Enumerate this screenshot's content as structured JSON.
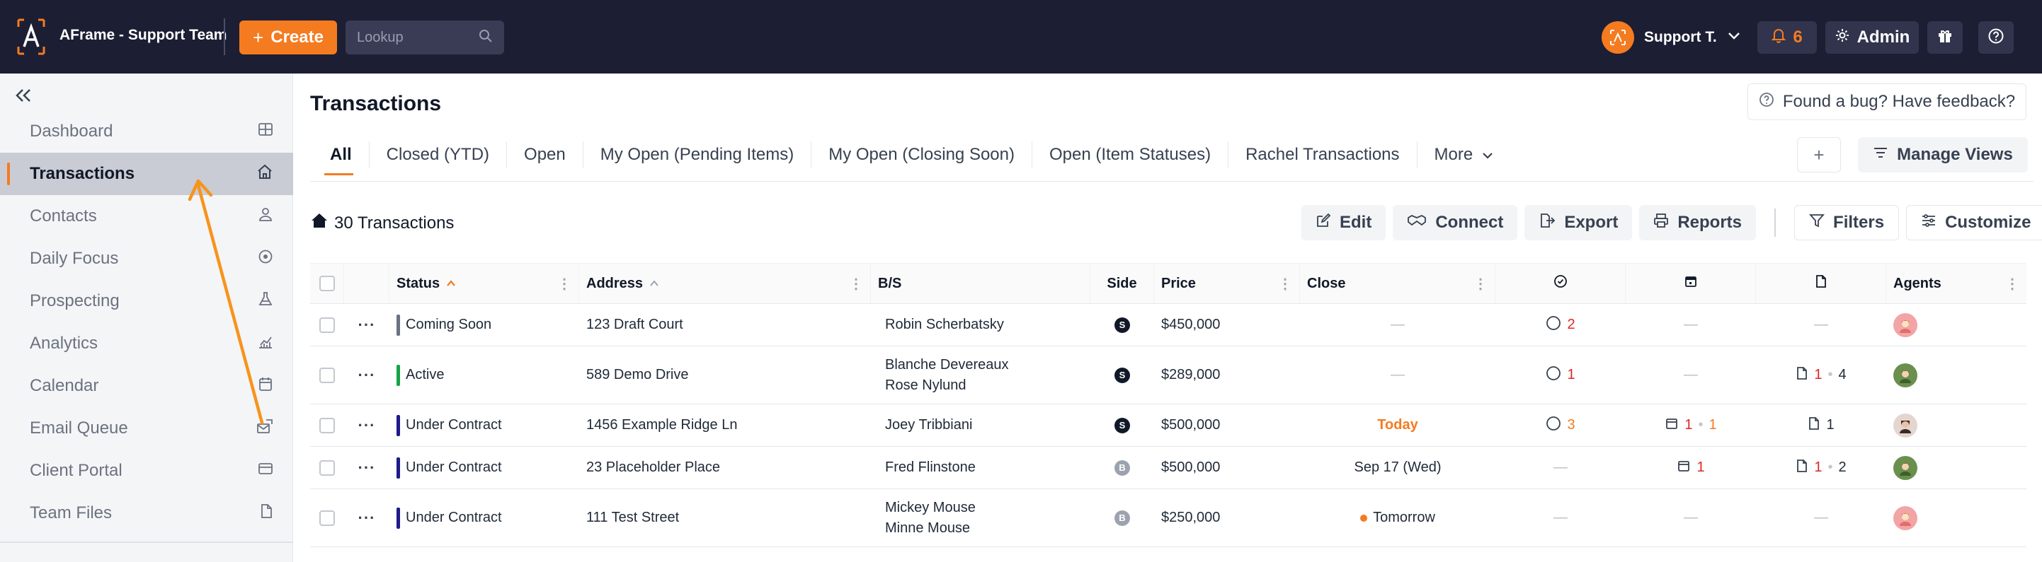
{
  "app": {
    "title": "AFrame - Support Team",
    "create_label": "Create",
    "lookup_placeholder": "Lookup"
  },
  "user": {
    "name": "Support T.",
    "notifications": "6",
    "admin_label": "Admin"
  },
  "colors": {
    "brand": "#f47b20",
    "topbar": "#1c1e34",
    "sidebar": "#f4f5f7"
  },
  "sidebar": {
    "items": [
      {
        "label": "Dashboard",
        "icon": "grid-icon"
      },
      {
        "label": "Transactions",
        "icon": "home-icon",
        "active": true
      },
      {
        "label": "Contacts",
        "icon": "person-icon"
      },
      {
        "label": "Daily Focus",
        "icon": "target-icon"
      },
      {
        "label": "Prospecting",
        "icon": "flask-icon"
      },
      {
        "label": "Analytics",
        "icon": "chart-icon"
      },
      {
        "label": "Calendar",
        "icon": "calendar-icon"
      },
      {
        "label": "Email Queue",
        "icon": "email-queue-icon"
      },
      {
        "label": "Client Portal",
        "icon": "portal-icon"
      },
      {
        "label": "Team Files",
        "icon": "file-icon"
      }
    ]
  },
  "main": {
    "title": "Transactions",
    "feedback": "Found a bug? Have feedback?",
    "tabs": [
      "All",
      "Closed (YTD)",
      "Open",
      "My Open (Pending Items)",
      "My Open (Closing Soon)",
      "Open (Item Statuses)",
      "Rachel Transactions",
      "More"
    ],
    "manage_views": "Manage Views",
    "count": "30 Transactions",
    "toolbar": {
      "edit": "Edit",
      "connect": "Connect",
      "export": "Export",
      "reports": "Reports",
      "filters": "Filters",
      "customize": "Customize"
    }
  },
  "table": {
    "headers": {
      "status": "Status",
      "address": "Address",
      "bs": "B/S",
      "side": "Side",
      "price": "Price",
      "close": "Close",
      "agents": "Agents"
    },
    "rows": [
      {
        "status": "Coming Soon",
        "status_color": "#6b7280",
        "address": "123 Draft Court",
        "bs": [
          "Robin Scherbatsky"
        ],
        "side": "S",
        "side_color": "#111827",
        "price": "$450,000",
        "close": "—",
        "tasks": "2",
        "cal": "",
        "cal2": "",
        "docs": "",
        "docs2": ""
      },
      {
        "status": "Active",
        "status_color": "#16a34a",
        "address": "589 Demo Drive",
        "bs": [
          "Blanche Devereaux",
          "Rose Nylund"
        ],
        "side": "S",
        "side_color": "#111827",
        "price": "$289,000",
        "close": "—",
        "tasks": "1",
        "cal": "",
        "cal2": "",
        "docs": "1",
        "docs2": "4"
      },
      {
        "status": "Under Contract",
        "status_color": "#1e1b8a",
        "address": "1456 Example Ridge Ln",
        "bs": [
          "Joey Tribbiani"
        ],
        "side": "S",
        "side_color": "#111827",
        "price": "$500,000",
        "close": "Today",
        "tasks": "3",
        "cal": "1",
        "cal2": "1",
        "docs": "1",
        "docs2": ""
      },
      {
        "status": "Under Contract",
        "status_color": "#1e1b8a",
        "address": "23 Placeholder Place",
        "bs": [
          "Fred Flinstone"
        ],
        "side": "B",
        "side_color": "#9ca3af",
        "price": "$500,000",
        "close": "Sep 17 (Wed)",
        "tasks": "",
        "cal": "1",
        "cal2": "",
        "docs": "1",
        "docs2": "2"
      },
      {
        "status": "Under Contract",
        "status_color": "#1e1b8a",
        "address": "111 Test Street",
        "bs": [
          "Mickey Mouse",
          "Minne Mouse"
        ],
        "side": "B",
        "side_color": "#9ca3af",
        "price": "$250,000",
        "close": "Tomorrow",
        "tasks": "",
        "cal": "",
        "cal2": "",
        "docs": "",
        "docs2": ""
      }
    ]
  }
}
